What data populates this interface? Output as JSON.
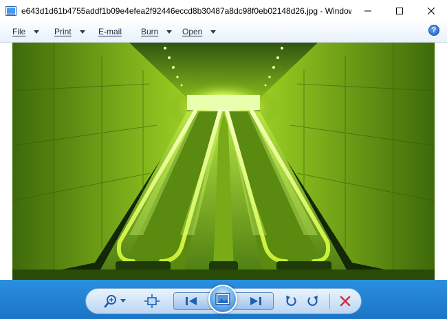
{
  "window": {
    "title": "e643d1d61b4755addf1b09e4efea2f92446eccd8b30487a8dc98f0eb02148d26.jpg - Windows ...",
    "controls": {
      "minimize": "—",
      "maximize": "☐",
      "close": "✕"
    }
  },
  "menu": {
    "items": [
      {
        "label": "File"
      },
      {
        "label": "Print"
      },
      {
        "label": "E-mail"
      },
      {
        "label": "Burn"
      },
      {
        "label": "Open"
      }
    ],
    "help_label": "?"
  },
  "image": {
    "description_icon": "photo-escalators"
  },
  "toolbar": {
    "zoom_icon": "zoom-icon",
    "fit_icon": "actual-size-icon",
    "prev_icon": "previous-icon",
    "slideshow_icon": "slideshow-icon",
    "next_icon": "next-icon",
    "rotate_ccw_icon": "rotate-left-icon",
    "rotate_cw_icon": "rotate-right-icon",
    "delete_icon": "delete-icon"
  },
  "colors": {
    "accent_blue": "#1b74c6",
    "delete_red": "#d0303a"
  }
}
